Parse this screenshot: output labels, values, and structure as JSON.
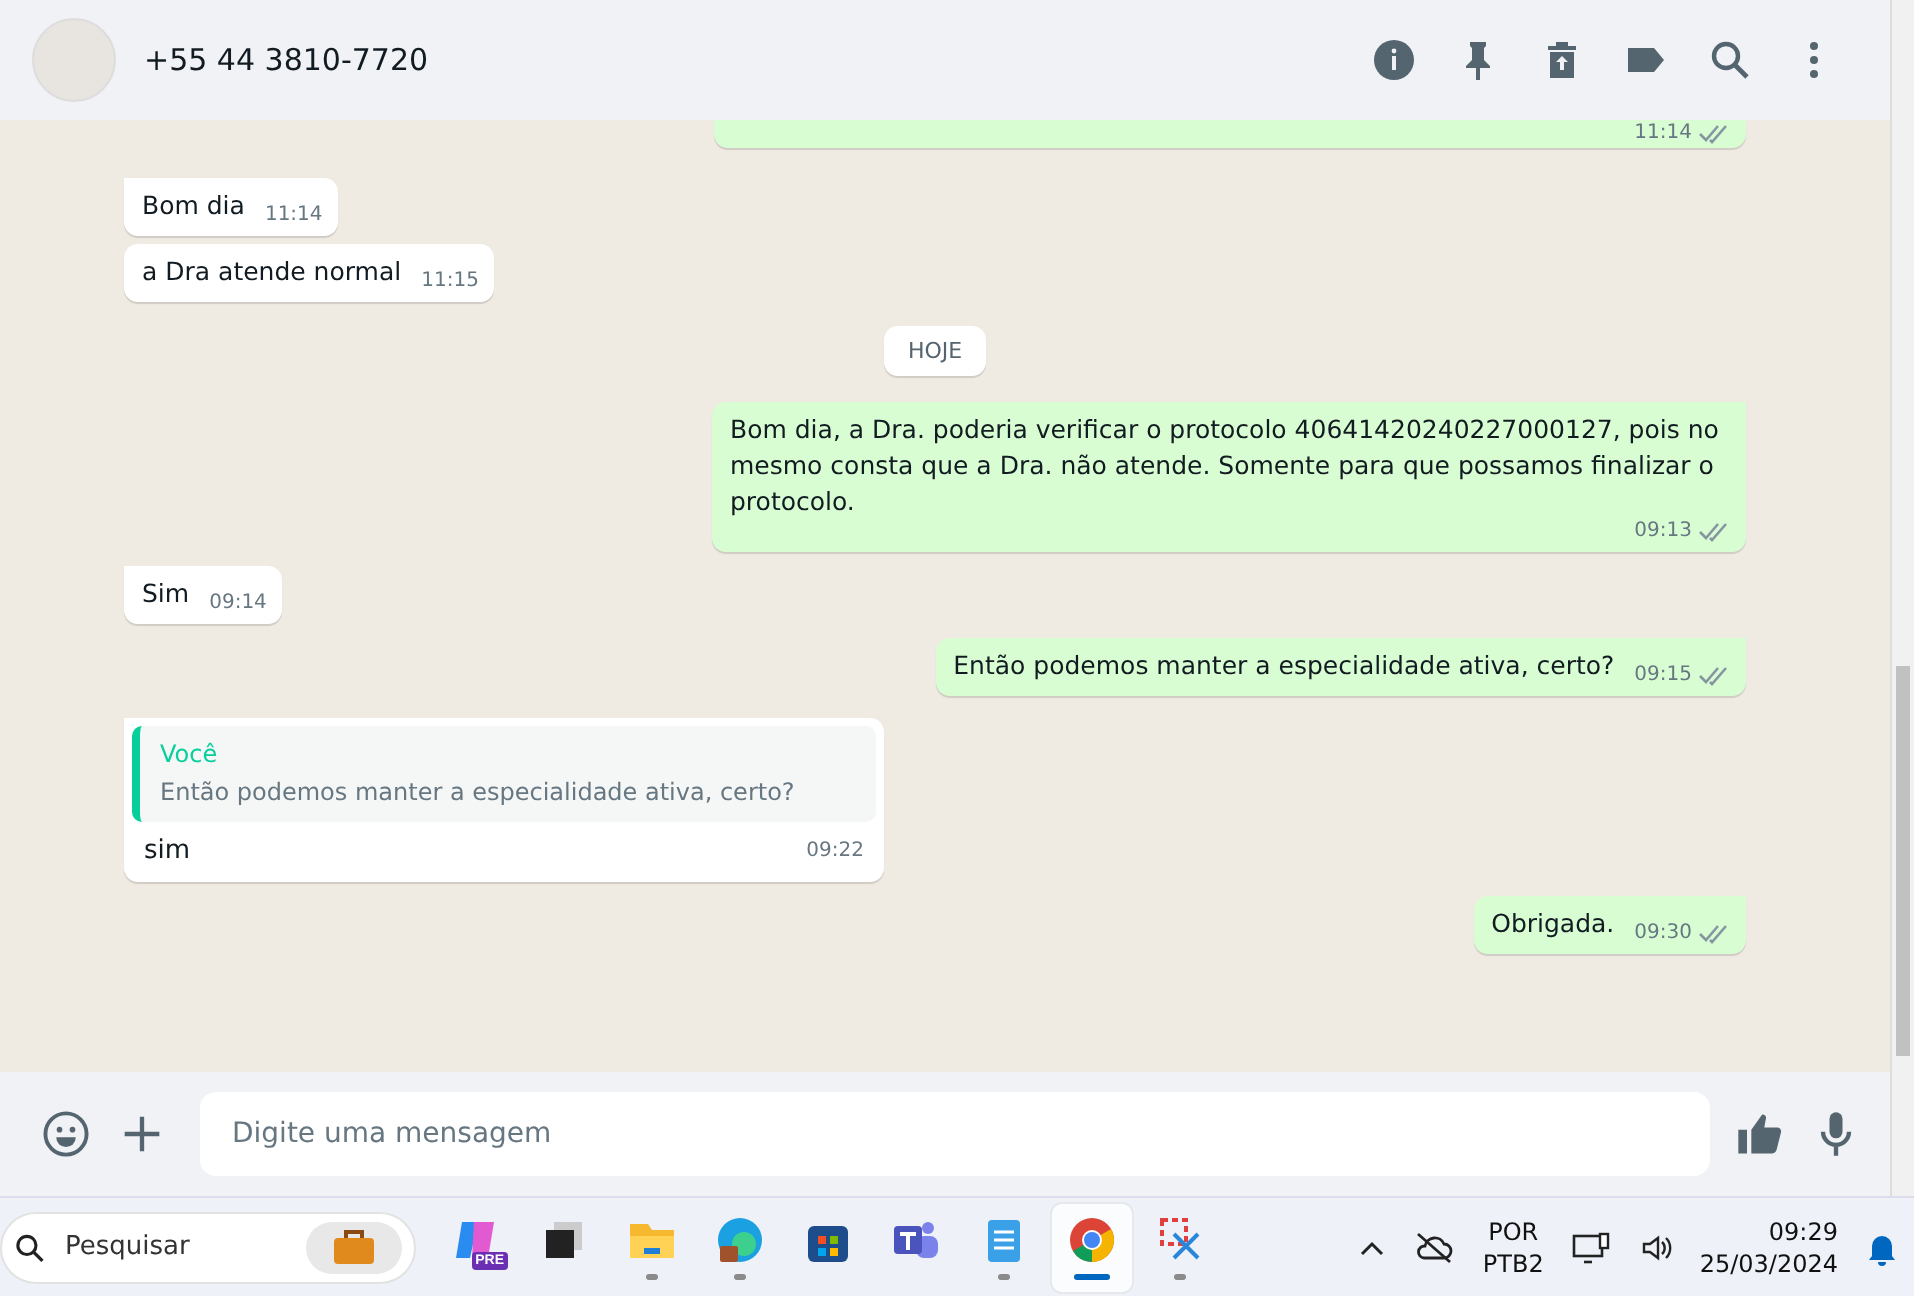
{
  "header": {
    "contact": "+55 44 3810-7720"
  },
  "messages": [
    {
      "kind": "out_cut",
      "time": "11:14"
    },
    {
      "kind": "in",
      "text": "Bom dia",
      "time": "11:14",
      "tail": true
    },
    {
      "kind": "in",
      "text": "a Dra atende normal",
      "time": "11:15",
      "tail": false
    },
    {
      "kind": "date",
      "text": "HOJE"
    },
    {
      "kind": "out",
      "text": "Bom dia, a Dra. poderia verificar o protocolo 40641420240227000127, pois no mesmo consta que a Dra. não atende. Somente para que possamos finalizar o protocolo.",
      "time": "09:13",
      "tail": true
    },
    {
      "kind": "in",
      "text": "Sim",
      "time": "09:14",
      "tail": true
    },
    {
      "kind": "out",
      "text": "Então podemos manter a especialidade ativa, certo?",
      "time": "09:15",
      "tail": true
    },
    {
      "kind": "reply",
      "quote_author": "Você",
      "quote_text": "Então podemos manter a especialidade ativa, certo?",
      "text": "sim",
      "time": "09:22",
      "tail": true
    },
    {
      "kind": "out",
      "text": "Obrigada.",
      "time": "09:30",
      "tail": true
    }
  ],
  "composer": {
    "placeholder": "Digite uma mensagem"
  },
  "taskbar": {
    "search_placeholder": "Pesquisar",
    "apps": [
      {
        "kind": "copilot",
        "badge": "PRE",
        "running": false,
        "selected": false
      },
      {
        "kind": "taskview",
        "running": false,
        "selected": false
      },
      {
        "kind": "explorer",
        "running": true,
        "selected": false
      },
      {
        "kind": "edge",
        "running": true,
        "selected": false
      },
      {
        "kind": "store",
        "running": false,
        "selected": false
      },
      {
        "kind": "teams",
        "running": false,
        "selected": false
      },
      {
        "kind": "notepad",
        "running": true,
        "selected": false
      },
      {
        "kind": "chrome",
        "running": true,
        "selected": true
      },
      {
        "kind": "snip",
        "running": true,
        "selected": false
      }
    ],
    "language": "POR",
    "layout": "PTB2",
    "time": "09:29",
    "date": "25/03/2024"
  }
}
